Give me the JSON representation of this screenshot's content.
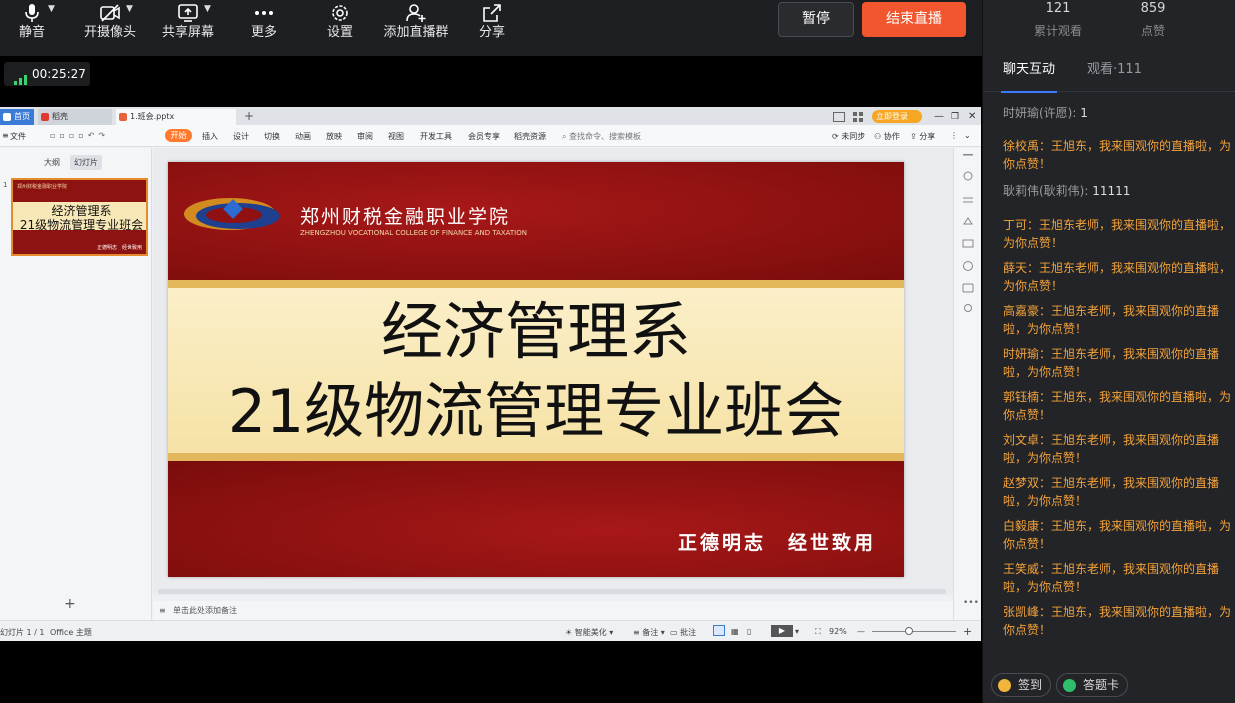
{
  "toolbar": {
    "tools": [
      {
        "label": "静音",
        "icon": "microphone-icon"
      },
      {
        "label": "开摄像头",
        "icon": "camera-off-icon"
      },
      {
        "label": "共享屏幕",
        "icon": "share-screen-icon"
      },
      {
        "label": "更多",
        "icon": "more-dots-icon"
      },
      {
        "label": "设置",
        "icon": "gear-icon"
      },
      {
        "label": "添加直播群",
        "icon": "add-group-icon"
      },
      {
        "label": "分享",
        "icon": "share-icon"
      }
    ],
    "pause_label": "暂停",
    "end_label": "结束直播"
  },
  "stats": {
    "views_count": "121",
    "views_label": "累计观看",
    "likes_count": "859",
    "likes_label": "点赞"
  },
  "side_tabs": {
    "chat": "聊天互动",
    "viewers": "观看·111"
  },
  "chat": [
    {
      "name": "时妍瑜(许愿)",
      "text": "1",
      "style": "grey"
    },
    {
      "name": "徐校禹",
      "text": "王旭东，我来围观你的直播啦，为你点赞！",
      "style": "orange"
    },
    {
      "name": "耿莉伟(耿莉伟)",
      "text": "11111",
      "style": "grey"
    },
    {
      "name": "丁可",
      "text": "王旭东老师，我来围观你的直播啦，为你点赞！",
      "style": "orange"
    },
    {
      "name": "薛天",
      "text": "王旭东老师，我来围观你的直播啦，为你点赞！",
      "style": "orange"
    },
    {
      "name": "高嘉豪",
      "text": "王旭东老师，我来围观你的直播啦，为你点赞！",
      "style": "orange"
    },
    {
      "name": "时妍瑜",
      "text": "王旭东老师，我来围观你的直播啦，为你点赞！",
      "style": "orange"
    },
    {
      "name": "郭钰楠",
      "text": "王旭东，我来围观你的直播啦，为你点赞！",
      "style": "orange"
    },
    {
      "name": "刘文卓",
      "text": "王旭东老师，我来围观你的直播啦，为你点赞！",
      "style": "orange"
    },
    {
      "name": "赵梦双",
      "text": "王旭东老师，我来围观你的直播啦，为你点赞！",
      "style": "orange"
    },
    {
      "name": "白毅康",
      "text": "王旭东，我来围观你的直播啦，为你点赞！",
      "style": "orange"
    },
    {
      "name": "王笑威",
      "text": "王旭东老师，我来围观你的直播啦，为你点赞！",
      "style": "orange"
    },
    {
      "name": "张凯峰",
      "text": "王旭东，我来围观你的直播啦，为你点赞！",
      "style": "orange"
    }
  ],
  "bottom_actions": {
    "checkin": "签到",
    "answer_card": "答题卡"
  },
  "live_timer": "00:25:27",
  "wps": {
    "tabs": [
      "首页",
      "稻壳",
      "1.班会.pptx"
    ],
    "vip_button": "立即登录",
    "ribbon_menu": [
      "文件",
      "开始",
      "插入",
      "设计",
      "切换",
      "动画",
      "放映",
      "审阅",
      "视图",
      "开发工具",
      "会员专享",
      "稻壳资源"
    ],
    "search_placeholder": "查找命令、搜索模板",
    "sync_status": "未同步",
    "collab": "协作",
    "share": "分享",
    "pane_tabs": [
      "大纲",
      "幻灯片"
    ],
    "thumb_number": "1",
    "notes_placeholder": "单击此处添加备注",
    "status": {
      "slide_counter": "幻灯片 1 / 1",
      "theme": "Office 主题",
      "smart_beautify": "智能美化",
      "notes": "备注",
      "comments": "批注",
      "zoom": "92%"
    }
  },
  "slide": {
    "school_cn": "郑州财税金融职业学院",
    "school_en": "ZHENGZHOU VOCATIONAL COLLEGE OF FINANCE AND TAXATION",
    "title_line1": "经济管理系",
    "title_line2": "21级物流管理专业班会",
    "motto": "正德明志　经世致用"
  },
  "colors": {
    "accent_orange": "#f2562f",
    "chat_orange": "#f3a23a",
    "tab_blue": "#3a7bff",
    "slide_red": "#8f1111",
    "slide_band": "#f8e8b8"
  }
}
